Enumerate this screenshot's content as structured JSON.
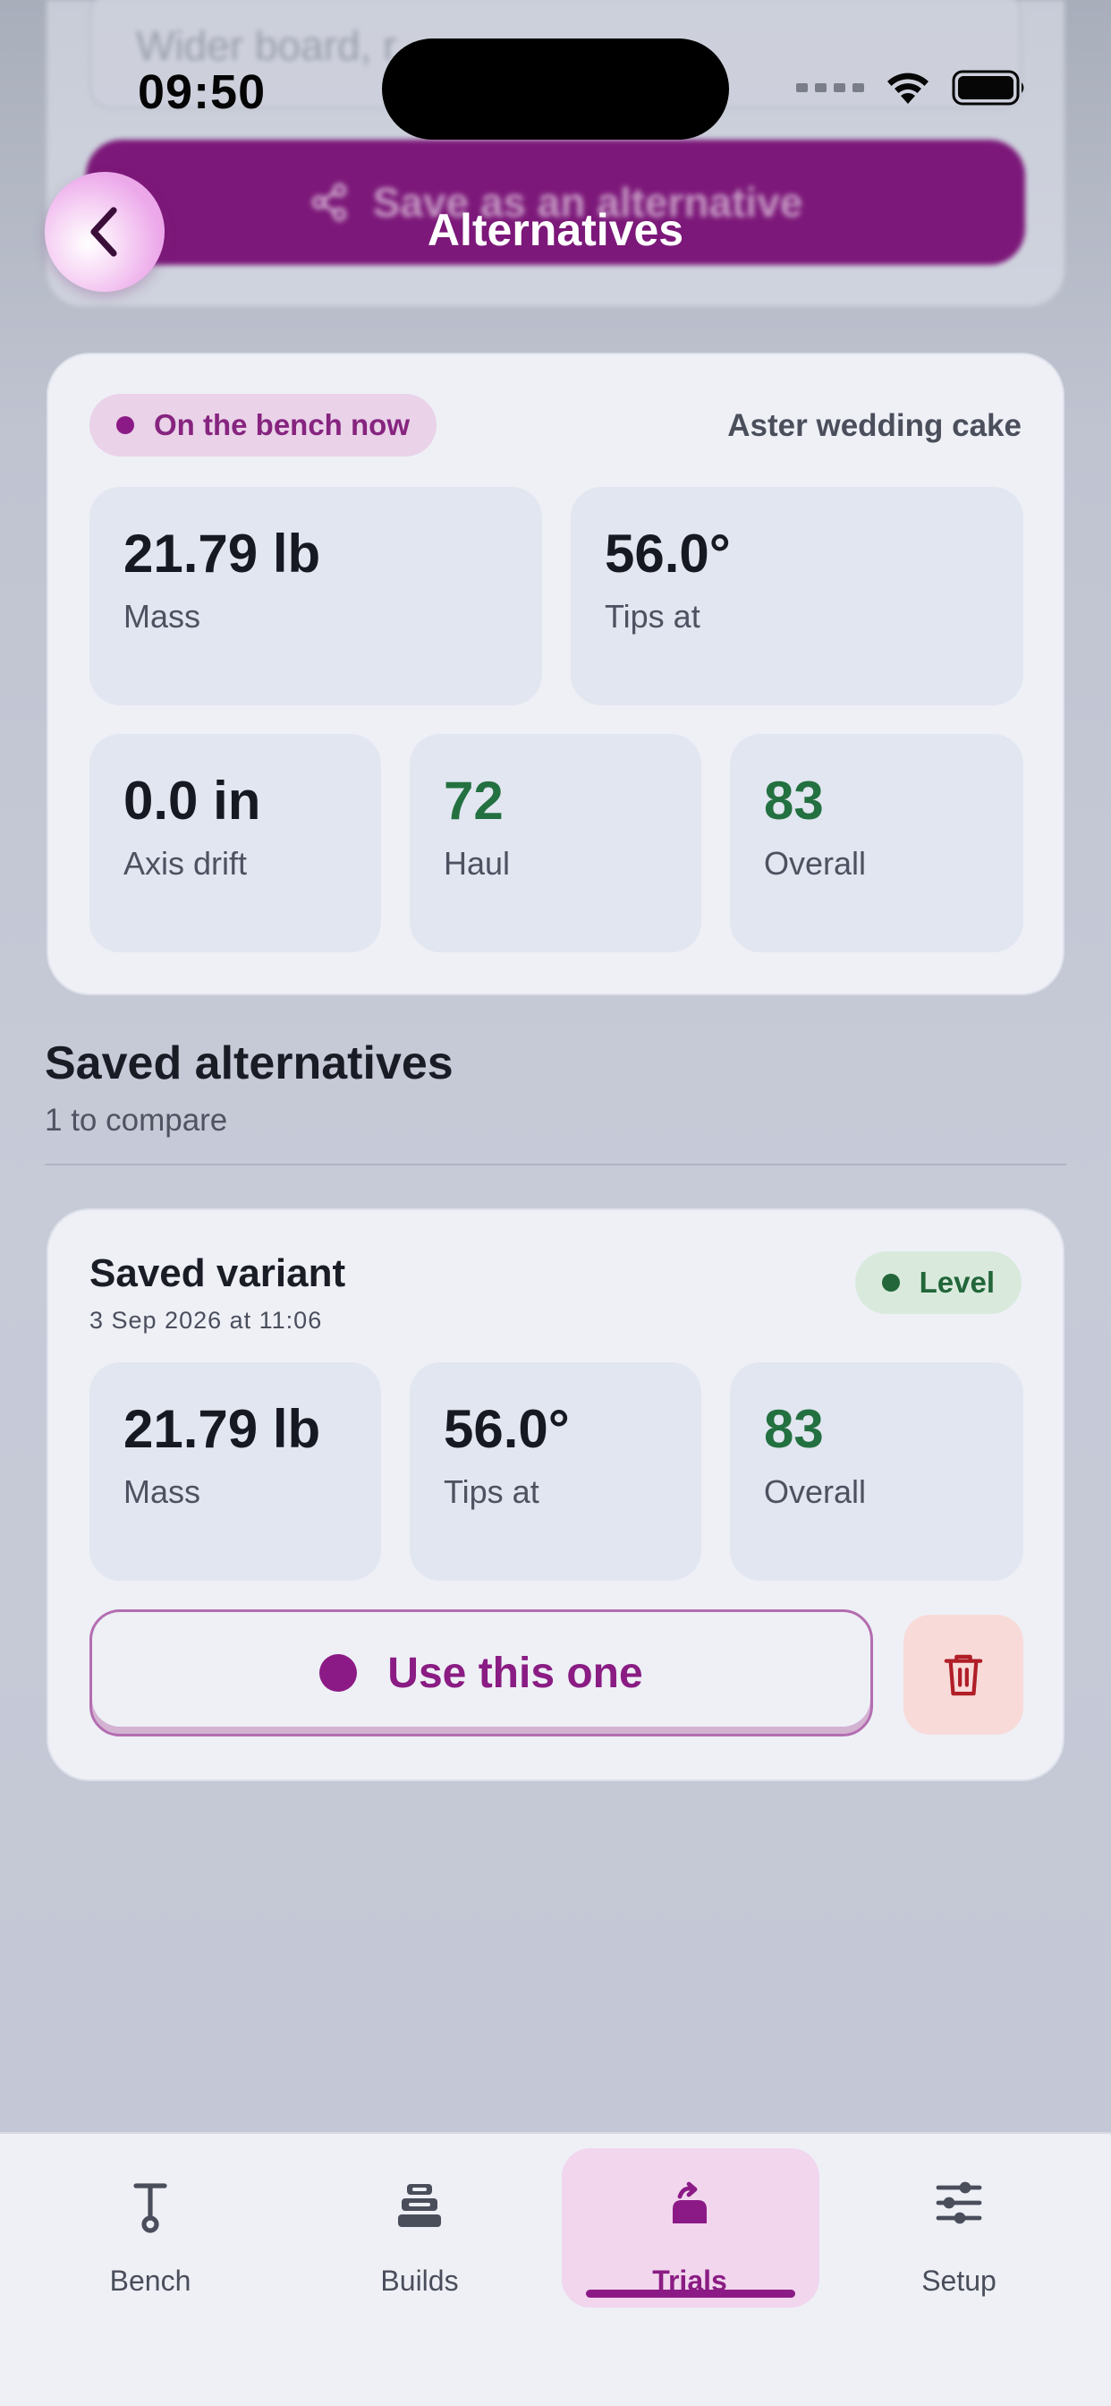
{
  "status_bar": {
    "time": "09:50"
  },
  "background": {
    "input_placeholder": "Wider board, r",
    "save_button_label": "Save as an alternative"
  },
  "header": {
    "title": "Alternatives"
  },
  "current": {
    "badge": "On the bench now",
    "project": "Aster wedding cake",
    "stats": [
      {
        "value": "21.79 lb",
        "label": "Mass"
      },
      {
        "value": "56.0°",
        "label": "Tips at"
      },
      {
        "value": "0.0 in",
        "label": "Axis drift"
      },
      {
        "value": "72",
        "label": "Haul"
      },
      {
        "value": "83",
        "label": "Overall"
      }
    ]
  },
  "saved_section": {
    "title": "Saved alternatives",
    "subtitle": "1 to compare"
  },
  "saved_items": [
    {
      "title": "Saved variant",
      "date": "3 Sep 2026 at 11:06",
      "badge": "Level",
      "stats": [
        {
          "value": "21.79 lb",
          "label": "Mass"
        },
        {
          "value": "56.0°",
          "label": "Tips at"
        },
        {
          "value": "83",
          "label": "Overall"
        }
      ],
      "use_label": "Use this one"
    }
  ],
  "tabs": [
    {
      "label": "Bench",
      "icon": "bench-tool-icon"
    },
    {
      "label": "Builds",
      "icon": "stack-icon"
    },
    {
      "label": "Trials",
      "icon": "trial-cake-icon",
      "active": true
    },
    {
      "label": "Setup",
      "icon": "sliders-icon"
    }
  ],
  "colors": {
    "accent": "#8c1a86",
    "accent_soft": "#f1d6ee",
    "positive": "#237040",
    "danger": "#b01e28",
    "card": "#eef0f6",
    "stat_tile": "#e1e6f0"
  }
}
